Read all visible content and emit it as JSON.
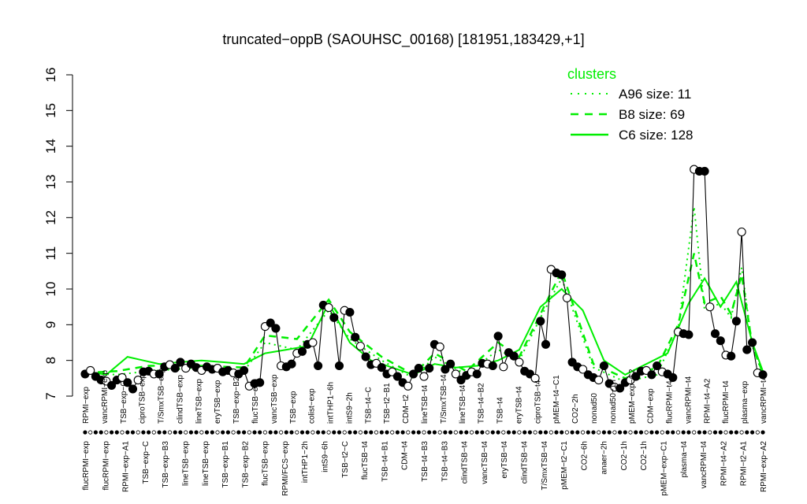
{
  "chart_data": {
    "type": "line",
    "title": "truncated−oppB (SAOUHSC_00168) [181951,183429,+1]",
    "ylim": [
      7,
      16
    ],
    "yticks": [
      7,
      8,
      9,
      10,
      11,
      12,
      13,
      14,
      15,
      16
    ],
    "grid": false,
    "legend_position": "top-right",
    "legend_title": "clusters",
    "accent_color": "#00ee00",
    "series": [
      {
        "name": "A96 size: 11",
        "style": "dotted"
      },
      {
        "name": "B8 size: 69",
        "style": "dashed"
      },
      {
        "name": "C6 size: 128",
        "style": "solid"
      }
    ],
    "top_labels": [
      "RPMI−exp",
      "vancRPMI−exp",
      "TSB−exp−C",
      "ciproTSB−exp",
      "T/SmxTSB−exp",
      "clindTSB−exp",
      "lineTSB−exp",
      "eryTSB−exp",
      "TSB−exp−B2",
      "flucTSB−exp",
      "vancTSB−exp",
      "TSB−exp",
      "colist−exp",
      "intTHP1−6h",
      "intS9−2h",
      "TSB−t4−C",
      "TSB−t2−B1",
      "CDM−t2",
      "lineTSB−t4",
      "T/SmxTSB−t4",
      "lineTSB−t4",
      "TSB−t4−B2",
      "TSB−t4",
      "eryTSB−t4",
      "ciproTSB−t4",
      "pMEM−t4−C1",
      "CO2−2h",
      "nonad50",
      "nonad50−1h",
      "pMEM−exp−C2",
      "CDM−exp",
      "flucRPMI−t4",
      "vancRPMI−t4",
      "RPMI−t4−A2",
      "flucRPMI−t4",
      "plasma−exp",
      "vancRPMI−t4"
    ],
    "bottom_labels": [
      "flucRPMI−exp",
      "flucRPMI−exp",
      "RPMI−exp−A1",
      "TSB−exp−C",
      "TSB−exp−B3",
      "lineTSB−exp",
      "lineTSB−exp",
      "TSB−exp−B1",
      "TSB−exp−B2",
      "flucTSB−exp",
      "RPMI/FCS−exp",
      "intTHP1−2h",
      "intS9−6h",
      "TSB−t2−C",
      "flucTSB−t4",
      "TSB−t4−B1",
      "CDM−t4",
      "TSB−t4−B3",
      "TSB−t4−B3",
      "clindTSB−t4",
      "vancTSB−t4",
      "eryTSB−t4",
      "clindTSB−t4",
      "T/SmxTSB−t4",
      "pMEM−t2−C1",
      "CO2−6h",
      "anaer−2h",
      "CO2−1h",
      "CO2−1h",
      "pMEM−exp−C1",
      "plasma−t4",
      "vancRPMI−t4",
      "RPMI−t4−A2",
      "RPMI−t2−A1",
      "RPMI−exp−A2"
    ],
    "x": [
      0,
      1,
      2,
      3,
      4,
      5,
      6,
      7,
      8,
      9,
      10,
      11,
      12,
      13,
      14,
      15,
      16,
      17,
      18,
      19,
      20,
      21,
      22,
      23,
      24,
      25,
      26,
      27,
      28,
      29,
      30,
      31,
      32,
      33,
      34,
      35,
      36,
      37,
      38,
      39,
      40,
      41,
      42,
      43,
      44,
      45,
      46,
      47,
      48,
      49,
      50,
      51,
      52,
      53,
      54,
      55,
      56,
      57,
      58,
      59,
      60,
      61,
      62,
      63,
      64,
      65,
      66,
      67,
      68,
      69,
      70,
      71,
      72,
      73,
      74,
      75,
      76,
      77,
      78,
      79,
      80,
      81,
      82,
      83,
      84,
      85,
      86,
      87,
      88,
      89,
      90,
      91,
      92,
      93,
      94,
      95,
      96,
      97,
      98,
      99,
      100,
      101,
      102,
      103,
      104,
      105,
      106,
      107,
      108,
      109,
      110,
      111,
      112,
      113,
      114,
      115,
      116,
      117,
      118,
      119,
      120,
      121,
      122,
      123,
      124,
      125,
      126,
      127,
      128,
      129,
      130,
      131,
      132,
      133,
      134,
      135,
      136,
      137,
      138,
      139,
      140,
      141,
      142,
      143,
      144,
      145,
      146,
      147,
      148,
      149,
      150,
      151,
      152,
      153,
      154
    ],
    "values": [
      7.62,
      7.72,
      7.55,
      7.45,
      7.42,
      7.3,
      7.45,
      7.52,
      7.38,
      7.2,
      7.45,
      7.68,
      7.7,
      7.62,
      7.62,
      7.82,
      7.88,
      7.78,
      7.95,
      7.78,
      7.9,
      7.8,
      7.72,
      7.82,
      7.75,
      7.78,
      7.68,
      7.72,
      7.65,
      7.62,
      7.72,
      7.28,
      7.35,
      7.38,
      8.95,
      9.05,
      8.9,
      7.85,
      7.82,
      7.9,
      8.2,
      8.25,
      8.45,
      8.5,
      7.85,
      9.55,
      9.48,
      9.2,
      7.85,
      9.4,
      9.35,
      8.65,
      8.4,
      8.1,
      7.88,
      7.92,
      7.8,
      7.62,
      7.68,
      7.55,
      7.38,
      7.28,
      7.62,
      7.78,
      7.55,
      7.78,
      8.45,
      8.38,
      7.75,
      7.9,
      7.62,
      7.45,
      7.58,
      7.68,
      7.62,
      7.92,
      7.9,
      7.85,
      8.68,
      7.82,
      8.22,
      8.12,
      7.95,
      7.7,
      7.62,
      7.5,
      9.1,
      8.45,
      10.55,
      10.45,
      10.4,
      9.75,
      7.95,
      7.82,
      7.75,
      7.6,
      7.52,
      7.45,
      7.85,
      7.35,
      7.25,
      7.22,
      7.38,
      7.45,
      7.55,
      7.7,
      7.72,
      7.6,
      7.85,
      7.68,
      7.62,
      7.52,
      8.8,
      8.75,
      8.72,
      13.35,
      13.3,
      13.3,
      9.5,
      8.75,
      8.55,
      8.15,
      8.12,
      9.1,
      11.6,
      8.3,
      8.5,
      7.65,
      7.6
    ],
    "series_a96_x": [
      0,
      6,
      12,
      22,
      30,
      34,
      40,
      46,
      50,
      56,
      62,
      66,
      72,
      78,
      82,
      86,
      90,
      96,
      102,
      108,
      112,
      115,
      117,
      120,
      122,
      124,
      126,
      128
    ],
    "series_a96": [
      7.65,
      7.6,
      7.7,
      7.8,
      7.7,
      8.5,
      8.3,
      9.4,
      8.6,
      8.0,
      7.5,
      8.1,
      7.6,
      8.3,
      8.0,
      9.2,
      10.3,
      7.8,
      7.4,
      7.6,
      8.9,
      12.3,
      9.4,
      9.6,
      9.2,
      10.6,
      8.4,
      7.6
    ],
    "series_b8_x": [
      0,
      6,
      12,
      22,
      30,
      34,
      40,
      46,
      50,
      56,
      62,
      66,
      72,
      78,
      82,
      86,
      90,
      96,
      102,
      108,
      112,
      115,
      117,
      120,
      122,
      124,
      126,
      128
    ],
    "series_b8": [
      7.65,
      7.7,
      7.85,
      7.85,
      7.8,
      8.7,
      8.6,
      9.7,
      8.8,
      8.1,
      7.6,
      8.2,
      7.7,
      8.5,
      8.1,
      9.3,
      10.5,
      7.9,
      7.5,
      7.8,
      9.0,
      11.0,
      9.6,
      9.8,
      9.3,
      10.4,
      8.4,
      7.65
    ],
    "series_c6_x": [
      0,
      4,
      8,
      11,
      14,
      18,
      22,
      26,
      30,
      34,
      38,
      42,
      46,
      50,
      54,
      58,
      62,
      66,
      70,
      74,
      78,
      82,
      86,
      90,
      94,
      98,
      102,
      106,
      110,
      114,
      117,
      120,
      123,
      126,
      128
    ],
    "series_c6": [
      7.7,
      7.6,
      8.1,
      8.0,
      7.9,
      7.95,
      8.0,
      7.95,
      7.9,
      8.2,
      8.3,
      8.4,
      9.6,
      8.5,
      8.0,
      7.8,
      7.6,
      7.9,
      7.8,
      7.85,
      8.0,
      8.3,
      9.5,
      10.0,
      9.4,
      8.0,
      7.6,
      7.9,
      8.2,
      9.6,
      10.3,
      9.5,
      10.2,
      8.5,
      7.7
    ]
  }
}
